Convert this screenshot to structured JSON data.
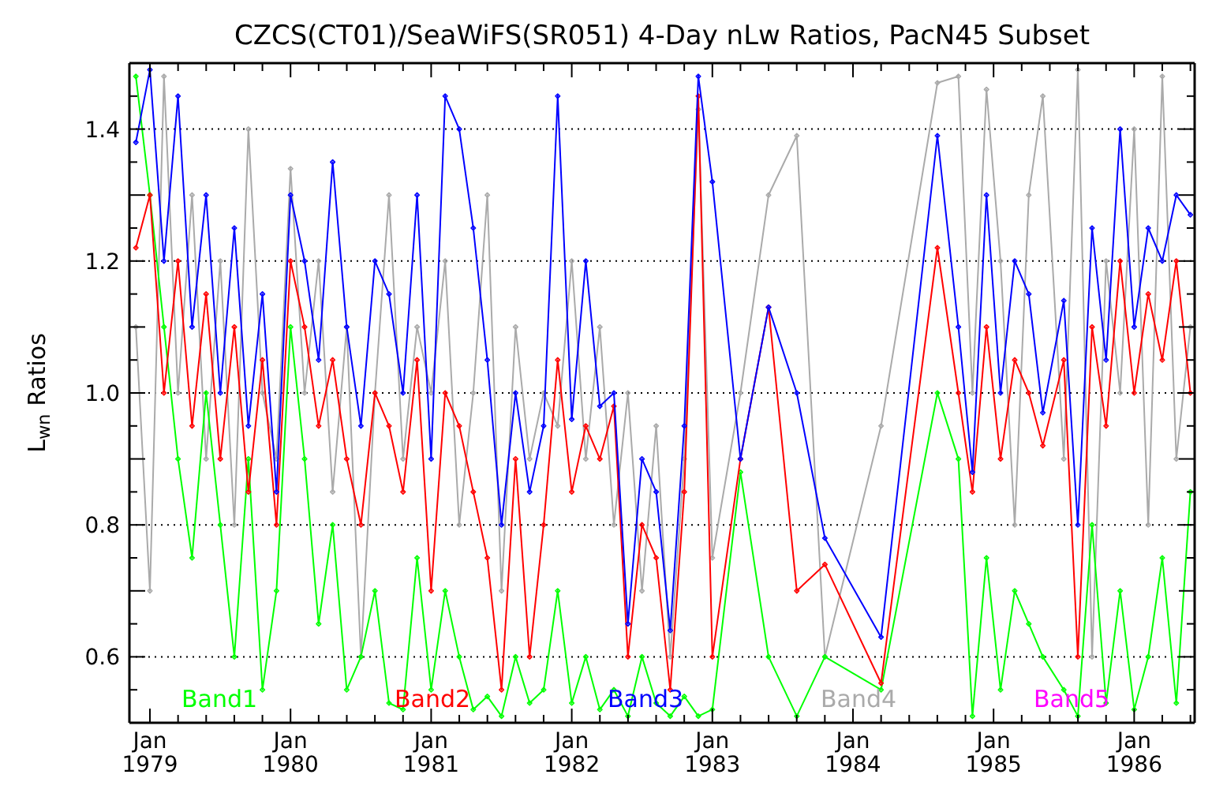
{
  "chart_data": {
    "type": "line",
    "title": "CZCS(CT01)/SeaWiFS(SR051) 4-Day nLw Ratios, PacN45 Subset",
    "ylabel": "L$_{wn}$ Ratios",
    "x": [
      1978.9,
      1979.0,
      1979.1,
      1979.2,
      1979.3,
      1979.4,
      1979.5,
      1979.6,
      1979.7,
      1979.8,
      1979.9,
      1980.0,
      1980.1,
      1980.2,
      1980.3,
      1980.4,
      1980.5,
      1980.6,
      1980.7,
      1980.8,
      1980.9,
      1981.0,
      1981.1,
      1981.2,
      1981.3,
      1981.4,
      1981.5,
      1981.6,
      1981.7,
      1981.8,
      1981.9,
      1982.0,
      1982.1,
      1982.2,
      1982.3,
      1982.4,
      1982.5,
      1982.6,
      1982.7,
      1982.8,
      1982.9,
      1983.0,
      1983.2,
      1983.4,
      1983.6,
      1983.8,
      1984.2,
      1984.6,
      1984.75,
      1984.85,
      1984.95,
      1985.05,
      1985.15,
      1985.25,
      1985.35,
      1985.5,
      1985.6,
      1985.7,
      1985.8,
      1985.9,
      1986.0,
      1986.1,
      1986.2,
      1986.3,
      1986.4
    ],
    "series": [
      {
        "name": "Band1",
        "color": "#00ff00",
        "values": [
          1.48,
          1.3,
          1.1,
          0.9,
          0.75,
          1.0,
          0.8,
          0.6,
          0.9,
          0.55,
          0.7,
          1.1,
          0.9,
          0.65,
          0.8,
          0.55,
          0.6,
          0.7,
          0.53,
          0.52,
          0.75,
          0.55,
          0.7,
          0.6,
          0.52,
          0.54,
          0.51,
          0.6,
          0.53,
          0.55,
          0.7,
          0.53,
          0.6,
          0.52,
          0.55,
          0.51,
          0.6,
          0.53,
          0.51,
          0.54,
          0.51,
          0.52,
          0.88,
          0.6,
          0.51,
          0.6,
          0.55,
          1.0,
          0.9,
          0.51,
          0.75,
          0.55,
          0.7,
          0.65,
          0.6,
          0.55,
          0.51,
          0.8,
          0.53,
          0.7,
          0.52,
          0.6,
          0.75,
          0.53,
          0.85
        ]
      },
      {
        "name": "Band2",
        "color": "#ff0000",
        "values": [
          1.22,
          1.3,
          1.0,
          1.2,
          0.95,
          1.15,
          0.9,
          1.1,
          0.85,
          1.05,
          0.8,
          1.2,
          1.1,
          0.95,
          1.05,
          0.9,
          0.8,
          1.0,
          0.95,
          0.85,
          1.05,
          0.7,
          1.0,
          0.95,
          0.85,
          0.75,
          0.55,
          0.9,
          0.6,
          0.8,
          1.05,
          0.85,
          0.95,
          0.9,
          0.98,
          0.6,
          0.8,
          0.75,
          0.55,
          0.85,
          1.45,
          0.6,
          0.9,
          1.13,
          0.7,
          0.74,
          0.56,
          1.22,
          1.0,
          0.85,
          1.1,
          0.9,
          1.05,
          1.0,
          0.92,
          1.05,
          0.6,
          1.1,
          0.95,
          1.2,
          1.0,
          1.15,
          1.05,
          1.2,
          1.0
        ]
      },
      {
        "name": "Band3",
        "color": "#0000ff",
        "values": [
          1.38,
          1.49,
          1.2,
          1.45,
          1.1,
          1.3,
          1.0,
          1.25,
          0.95,
          1.15,
          0.85,
          1.3,
          1.2,
          1.05,
          1.35,
          1.1,
          0.95,
          1.2,
          1.15,
          1.0,
          1.3,
          0.9,
          1.45,
          1.4,
          1.25,
          1.05,
          0.8,
          1.0,
          0.85,
          0.95,
          1.45,
          0.96,
          1.2,
          0.98,
          1.0,
          0.65,
          0.9,
          0.85,
          0.64,
          0.95,
          1.48,
          1.32,
          0.9,
          1.13,
          1.0,
          0.78,
          0.63,
          1.39,
          1.1,
          0.88,
          1.3,
          1.0,
          1.2,
          1.15,
          0.97,
          1.14,
          0.8,
          1.25,
          1.05,
          1.4,
          1.1,
          1.25,
          1.2,
          1.3,
          1.27
        ]
      },
      {
        "name": "Band4",
        "color": "#aaaaaa",
        "values": [
          1.1,
          0.7,
          1.48,
          1.0,
          1.3,
          0.9,
          1.2,
          0.8,
          1.4,
          1.0,
          0.9,
          1.34,
          1.0,
          1.2,
          0.85,
          1.1,
          0.6,
          1.0,
          1.3,
          0.9,
          1.1,
          1.0,
          1.2,
          0.8,
          1.0,
          1.3,
          0.7,
          1.1,
          0.9,
          1.0,
          0.95,
          1.2,
          0.9,
          1.1,
          0.8,
          1.0,
          0.7,
          0.95,
          0.6,
          0.9,
          1.43,
          0.75,
          1.0,
          1.3,
          1.39,
          0.6,
          0.95,
          1.47,
          1.48,
          1.0,
          1.46,
          1.2,
          0.8,
          1.3,
          1.45,
          0.9,
          1.49,
          0.6,
          1.2,
          1.0,
          1.4,
          0.8,
          1.48,
          0.9,
          1.1
        ]
      },
      {
        "name": "Band5",
        "color": "#ff00ff",
        "values": [
          null,
          null,
          null,
          null,
          null,
          null,
          null,
          null,
          null,
          null,
          null,
          null,
          null,
          null,
          null,
          null,
          null,
          null,
          null,
          null,
          null,
          null,
          null,
          null,
          null,
          null,
          null,
          null,
          null,
          null,
          null,
          null,
          null,
          null,
          null,
          null,
          null,
          null,
          null,
          null,
          null,
          null,
          null,
          null,
          null,
          null,
          null,
          null,
          null,
          null,
          null,
          null,
          null,
          null,
          null,
          null,
          null,
          null,
          null,
          null,
          null,
          null,
          null,
          null,
          null
        ]
      }
    ],
    "xlim": [
      1978.854,
      1986.43
    ],
    "ylim": [
      0.5,
      1.5
    ],
    "grid": true,
    "xticks": [
      {
        "value": 1979,
        "label": "1979"
      },
      {
        "value": 1980,
        "label": "1980"
      },
      {
        "value": 1981,
        "label": "1981"
      },
      {
        "value": 1982,
        "label": "1982"
      },
      {
        "value": 1983,
        "label": "1983"
      },
      {
        "value": 1984,
        "label": "1984"
      },
      {
        "value": 1985,
        "label": "1985"
      },
      {
        "value": 1986,
        "label": "1986"
      }
    ],
    "annotations": [
      "Jan",
      "Jan",
      "Jan",
      "Jan",
      "Jan",
      "Jan",
      "Jan",
      "Jan"
    ],
    "yticks": [
      {
        "value": 0.6,
        "label": "0.6"
      },
      {
        "value": 0.8,
        "label": "0.8"
      },
      {
        "value": 1.0,
        "label": "1.0"
      },
      {
        "value": 1.2,
        "label": "1.2"
      },
      {
        "value": 1.4,
        "label": "1.4"
      }
    ]
  }
}
